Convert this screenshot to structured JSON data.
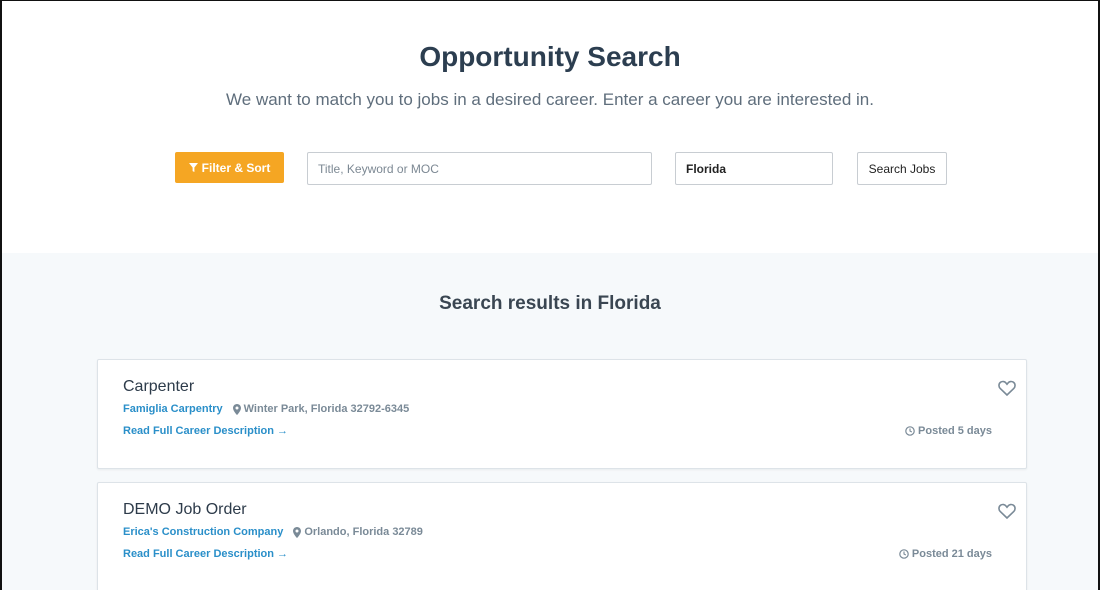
{
  "header": {
    "title": "Opportunity Search",
    "subtitle": "We want to match you to jobs in a desired career. Enter a career you are interested in."
  },
  "search": {
    "filter_label": "Filter & Sort",
    "keyword_placeholder": "Title, Keyword or MOC",
    "keyword_value": "",
    "location_value": "Florida",
    "search_button_label": "Search Jobs"
  },
  "results": {
    "heading": "Search results in Florida",
    "jobs": [
      {
        "title": "Carpenter",
        "company": "Famiglia Carpentry",
        "location": "Winter Park, Florida 32792-6345",
        "link_label": "Read Full Career Description →",
        "posted": "Posted 5 days"
      },
      {
        "title": "DEMO Job Order",
        "company": "Erica's Construction Company",
        "location": "Orlando, Florida 32789",
        "link_label": "Read Full Career Description →",
        "posted": "Posted 21 days"
      }
    ]
  },
  "colors": {
    "accent": "#f5a623",
    "link": "#2a8fc9",
    "heading": "#2c3e50",
    "results_bg": "#f6f9fb"
  },
  "icons": {
    "filter": "funnel-icon",
    "location": "map-pin-icon",
    "favorite": "heart-outline-icon",
    "posted": "clock-icon"
  }
}
